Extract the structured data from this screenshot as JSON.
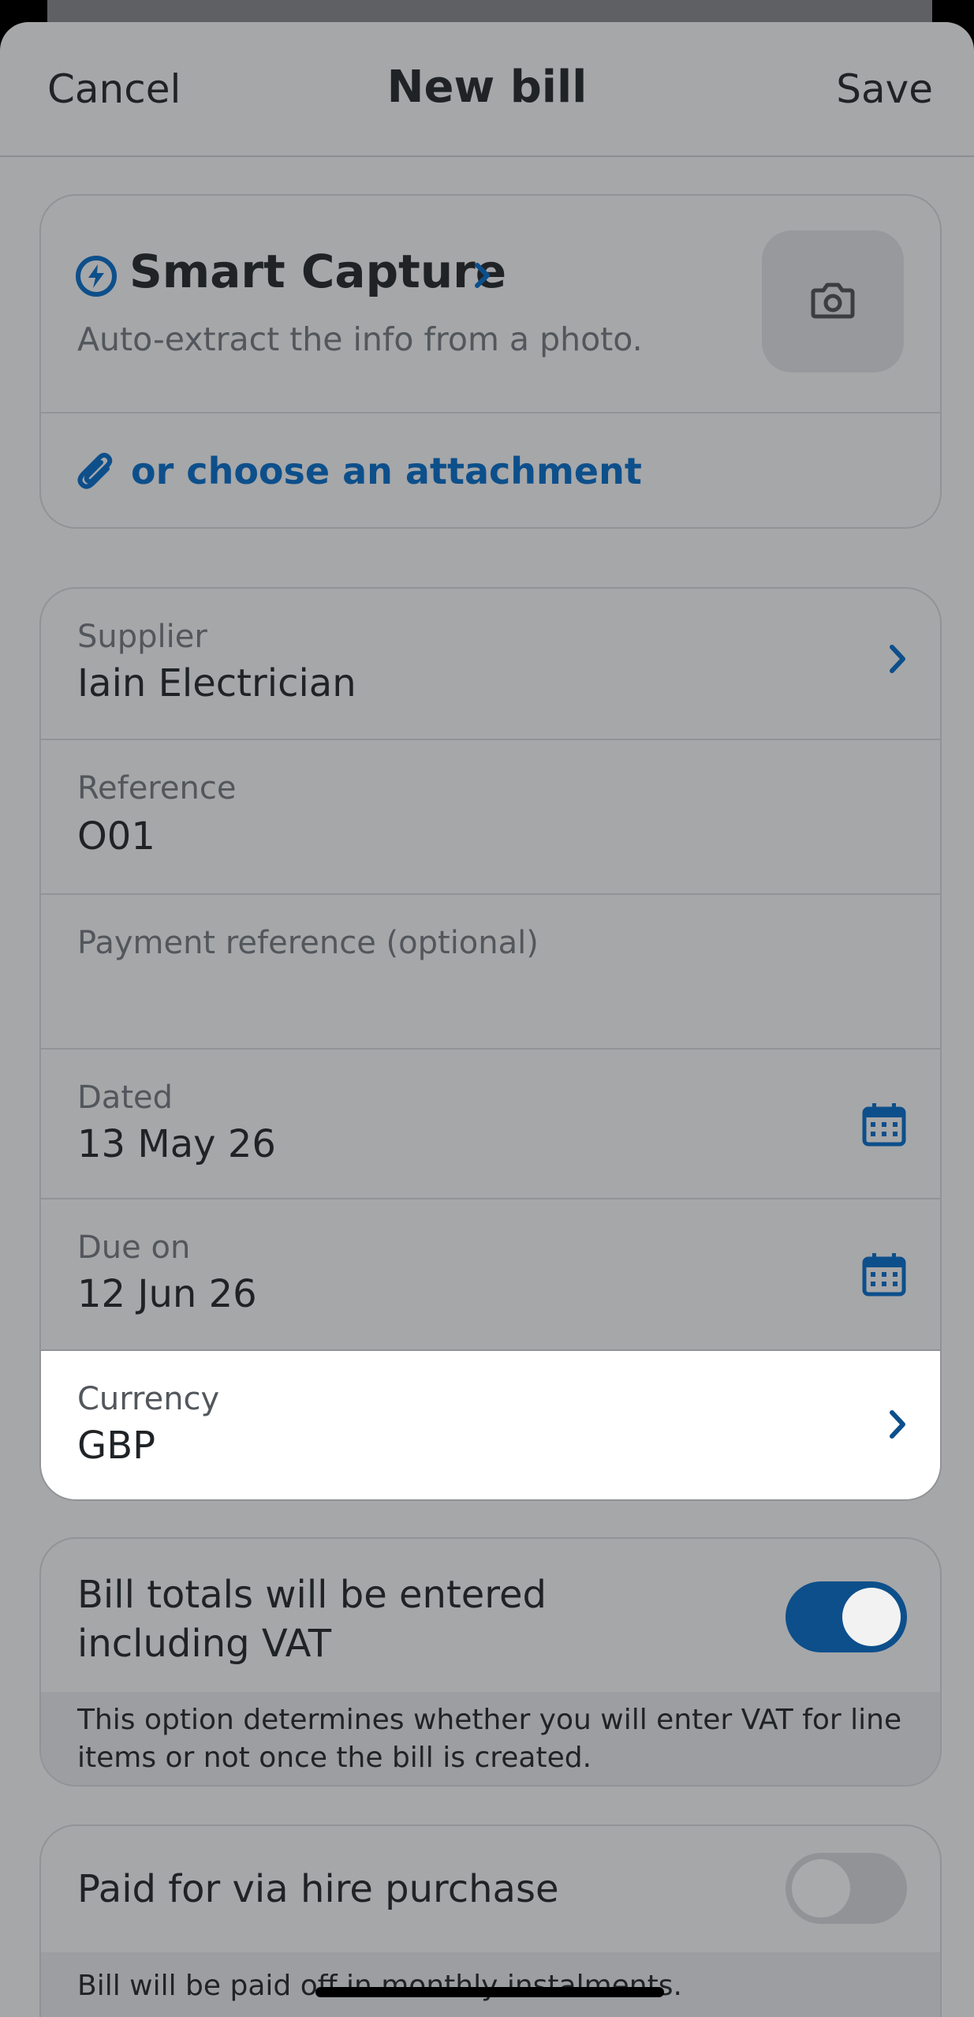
{
  "nav": {
    "cancel": "Cancel",
    "title": "New bill",
    "save": "Save"
  },
  "capture": {
    "title": "Smart Capture",
    "subtitle": "Auto-extract the info from a photo.",
    "attach_label": "or choose an attachment"
  },
  "fields": [
    {
      "label": "Supplier",
      "value": "Iain Electrician"
    },
    {
      "label": "Reference",
      "value": "O01"
    },
    {
      "label": "Payment reference (optional)",
      "value": ""
    },
    {
      "label": "Dated",
      "value": "13 May 26"
    },
    {
      "label": "Due on",
      "value": "12 Jun 26"
    },
    {
      "label": "Currency",
      "value": "GBP"
    }
  ],
  "vat": {
    "label": "Bill totals will be entered including VAT",
    "enabled": true,
    "description": "This option determines whether you will enter VAT for line items or not once the bill is created."
  },
  "hire_purchase": {
    "label": "Paid for via hire purchase",
    "enabled": false,
    "description": "Bill will be paid off in monthly instalments."
  },
  "colors": {
    "accent": "#0d4f8b",
    "dim_overlay": "#a6a7a9",
    "highlight": "#ffffff"
  }
}
